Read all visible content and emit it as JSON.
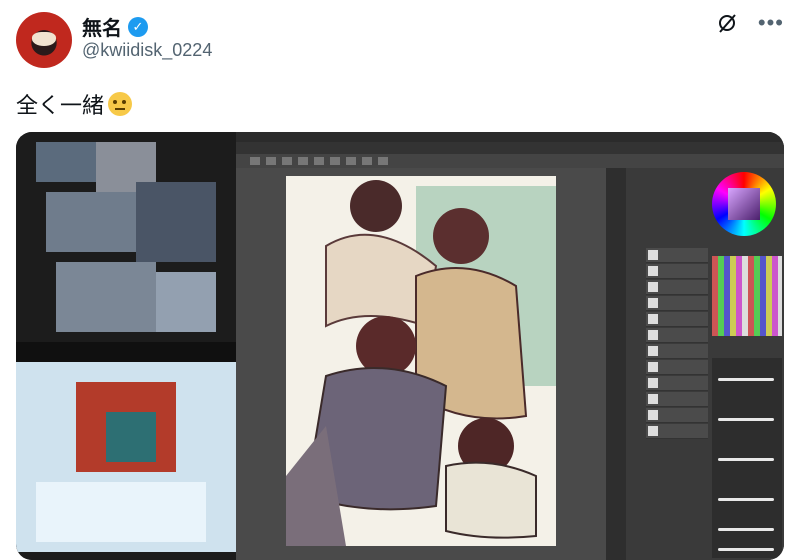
{
  "tweet": {
    "display_name": "無名",
    "handle": "@kwiidisk_0224",
    "text": "全く一緒",
    "verified_icon": "checkmark-icon",
    "emoji": "rolling-eyes-emoji",
    "colors": {
      "verified": "#1d9bf0",
      "handle": "#536471",
      "text": "#0f1419"
    }
  },
  "header_icons": [
    "grok-icon",
    "more-icon"
  ],
  "media": {
    "left_panel": "pixelated-censored-image",
    "right_panel": "drawing-app-screenshot"
  }
}
